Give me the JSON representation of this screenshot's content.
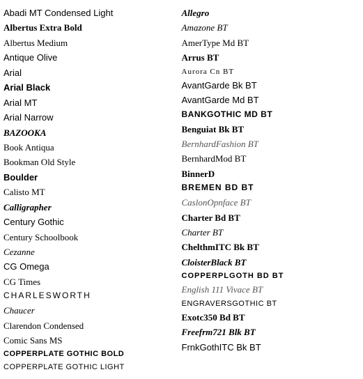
{
  "leftColumn": [
    {
      "text": "Abadi MT Condensed Light",
      "style": "normal",
      "font": "Arial, sans-serif"
    },
    {
      "text": "Albertus Extra Bold",
      "style": "bold",
      "font": "Georgia, serif"
    },
    {
      "text": "Albertus Medium",
      "style": "normal",
      "font": "Georgia, serif"
    },
    {
      "text": "Antique Olive",
      "style": "normal",
      "font": "Arial, sans-serif"
    },
    {
      "text": "Arial",
      "style": "normal",
      "font": "Arial, sans-serif"
    },
    {
      "text": "Arial Black",
      "style": "bold",
      "font": "'Arial Black', Arial, sans-serif"
    },
    {
      "text": "Arial MT",
      "style": "normal",
      "font": "Arial, sans-serif"
    },
    {
      "text": "Arial Narrow",
      "style": "normal",
      "font": "'Arial Narrow', Arial, sans-serif"
    },
    {
      "text": "BAZOOKA",
      "style": "bold-italic",
      "font": "Georgia, serif"
    },
    {
      "text": "Book Antiqua",
      "style": "normal",
      "font": "'Book Antiqua', Georgia, serif"
    },
    {
      "text": "Bookman Old Style",
      "style": "normal",
      "font": "'Bookman Old Style', Georgia, serif"
    },
    {
      "text": "Boulder",
      "style": "bold",
      "font": "Arial, sans-serif"
    },
    {
      "text": "Calisto MT",
      "style": "normal",
      "font": "Georgia, serif"
    },
    {
      "text": "Calligrapher",
      "style": "bold-italic-script",
      "font": "cursive"
    },
    {
      "text": "Century Gothic",
      "style": "normal",
      "font": "'Century Gothic', Arial, sans-serif"
    },
    {
      "text": "Century Schoolbook",
      "style": "normal",
      "font": "'Century Schoolbook', Georgia, serif"
    },
    {
      "text": "Cezanne",
      "style": "italic-script",
      "font": "cursive"
    },
    {
      "text": "CG Omega",
      "style": "normal",
      "font": "Arial, sans-serif"
    },
    {
      "text": "CG Times",
      "style": "normal",
      "font": "Georgia, serif"
    },
    {
      "text": "CHARLESWORTH",
      "style": "caps",
      "font": "Arial, sans-serif"
    },
    {
      "text": "Chaucer",
      "style": "italic",
      "font": "Georgia, serif"
    },
    {
      "text": "Clarendon Condensed",
      "style": "normal",
      "font": "Georgia, serif"
    },
    {
      "text": "Comic Sans MS",
      "style": "normal",
      "font": "'Comic Sans MS', cursive"
    },
    {
      "text": "COPPERPLATE GOTHIC BOLD",
      "style": "bold-smallcaps",
      "font": "Arial, sans-serif"
    },
    {
      "text": "Copperplate Gothic Light",
      "style": "smallcaps",
      "font": "Arial, sans-serif"
    }
  ],
  "rightColumn": [
    {
      "text": "Allegro",
      "style": "bold-italic",
      "font": "Georgia, serif"
    },
    {
      "text": "Amazone BT",
      "style": "italic-script",
      "font": "cursive"
    },
    {
      "text": "AmerType Md BT",
      "style": "normal",
      "font": "Georgia, serif"
    },
    {
      "text": "Arrus BT",
      "style": "bold",
      "font": "Georgia, serif"
    },
    {
      "text": "Aurora Cn BT",
      "style": "smallcaps-special",
      "font": "Georgia, serif"
    },
    {
      "text": "AvantGarde Bk BT",
      "style": "normal",
      "font": "Arial, sans-serif"
    },
    {
      "text": "AvantGarde Md BT",
      "style": "normal",
      "font": "Arial, sans-serif"
    },
    {
      "text": "BankGothic Md BT",
      "style": "bold-caps",
      "font": "Arial, sans-serif"
    },
    {
      "text": "Benguiat Bk BT",
      "style": "bold",
      "font": "Georgia, serif"
    },
    {
      "text": "BernhardFashion BT",
      "style": "light-script",
      "font": "Georgia, serif"
    },
    {
      "text": "BernhardMod BT",
      "style": "normal",
      "font": "Georgia, serif"
    },
    {
      "text": "BinnerD",
      "style": "bold",
      "font": "Georgia, serif"
    },
    {
      "text": "BREMEN BD BT",
      "style": "bold-caps",
      "font": "Arial, sans-serif"
    },
    {
      "text": "CaslonOpnface BT",
      "style": "light",
      "font": "Georgia, serif"
    },
    {
      "text": "Charter Bd BT",
      "style": "bold",
      "font": "Georgia, serif"
    },
    {
      "text": "Charter BT",
      "style": "italic",
      "font": "Georgia, serif"
    },
    {
      "text": "ChelthmITC Bk BT",
      "style": "bold",
      "font": "Georgia, serif"
    },
    {
      "text": "CloisterBlack BT",
      "style": "blackletter",
      "font": "Georgia, serif"
    },
    {
      "text": "CopperplGoth Bd BT",
      "style": "smallcaps-bold",
      "font": "Arial, sans-serif"
    },
    {
      "text": "English 111 Vivace BT",
      "style": "italic-script",
      "font": "cursive"
    },
    {
      "text": "EngraversGothic BT",
      "style": "smallcaps",
      "font": "Arial, sans-serif"
    },
    {
      "text": "Exotc350 Bd BT",
      "style": "bold",
      "font": "Georgia, serif"
    },
    {
      "text": "Freefrm721 Blk BT",
      "style": "bold-display",
      "font": "Georgia, serif"
    },
    {
      "text": "FrnkGothITC Bk BT",
      "style": "normal",
      "font": "Arial, sans-serif"
    }
  ]
}
